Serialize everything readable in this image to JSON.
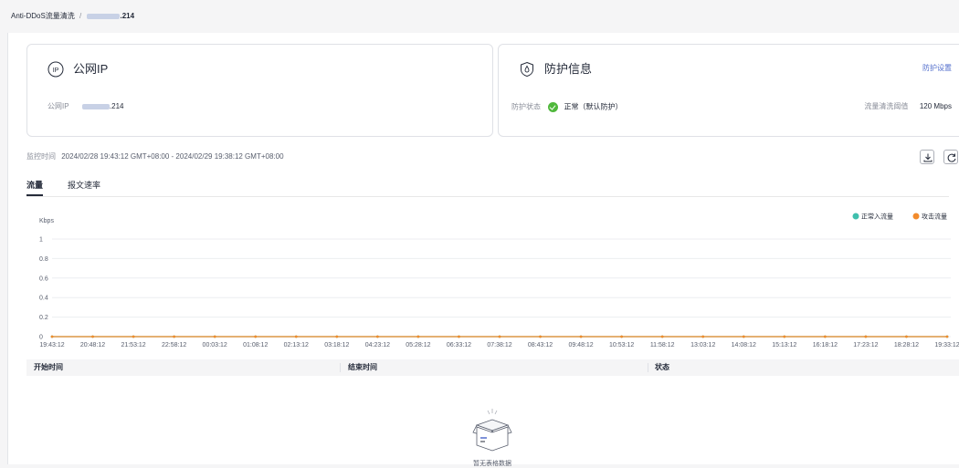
{
  "breadcrumb": {
    "root": "Anti-DDoS流量清洗",
    "separator": "/",
    "ip_suffix": ".214"
  },
  "ip_card": {
    "title": "公网IP",
    "ip_label": "公网IP",
    "ip_suffix": ".214"
  },
  "protection_card": {
    "title": "防护信息",
    "settings_link": "防护设置",
    "status_label": "防护状态",
    "status_value": "正常（默认防护）",
    "threshold_label": "流量清洗阈值",
    "threshold_value": "120 Mbps"
  },
  "monitor": {
    "label": "监控时间",
    "range": "2024/02/28 19:43:12 GMT+08:00 - 2024/02/29 19:38:12 GMT+08:00"
  },
  "tabs": [
    {
      "label": "流量",
      "active": true
    },
    {
      "label": "报文速率",
      "active": false
    }
  ],
  "chart_data": {
    "type": "line",
    "ylabel": "Kbps",
    "ylim": [
      0,
      1
    ],
    "y_ticks": [
      "1",
      "0.8",
      "0.6",
      "0.4",
      "0.2",
      "0"
    ],
    "categories": [
      "19:43:12",
      "20:48:12",
      "21:53:12",
      "22:58:12",
      "00:03:12",
      "01:08:12",
      "02:13:12",
      "03:18:12",
      "04:23:12",
      "05:28:12",
      "06:33:12",
      "07:38:12",
      "08:43:12",
      "09:48:12",
      "10:53:12",
      "11:58:12",
      "13:03:12",
      "14:08:12",
      "15:13:12",
      "16:18:12",
      "17:23:12",
      "18:28:12",
      "19:33:12"
    ],
    "legend_position": "top-right",
    "grid": true,
    "series": [
      {
        "name": "正常入流量",
        "color": "#3fbfad",
        "values": [
          0,
          0,
          0,
          0,
          0,
          0,
          0,
          0,
          0,
          0,
          0,
          0,
          0,
          0,
          0,
          0,
          0,
          0,
          0,
          0,
          0,
          0,
          0
        ]
      },
      {
        "name": "攻击流量",
        "color": "#f28b2c",
        "values": [
          0,
          0,
          0,
          0,
          0,
          0,
          0,
          0,
          0,
          0,
          0,
          0,
          0,
          0,
          0,
          0,
          0,
          0,
          0,
          0,
          0,
          0,
          0
        ]
      }
    ]
  },
  "table": {
    "columns": [
      "开始时间",
      "结束时间",
      "状态"
    ],
    "empty_text": "暂无表格数据"
  },
  "colors": {
    "accent_link": "#526ecc",
    "ok": "#50b83c",
    "normal_series": "#3fbfad",
    "attack_series": "#f28b2c"
  }
}
